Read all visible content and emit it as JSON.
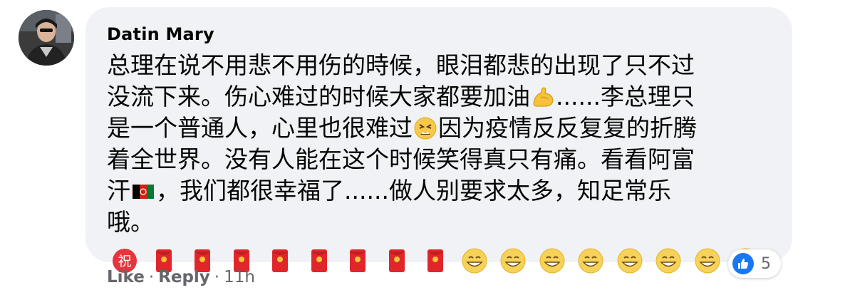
{
  "comment": {
    "author": "Datin Mary",
    "text_line1": "总理在说不用悲不用伤的時候，眼泪都悲的出现了只不过",
    "text_line2_a": "没流下来。伤心难过的时候大家都要加油",
    "text_line2_b": "......李总理只",
    "text_line3_a": "是一个普通人，心里也很难过",
    "text_line3_b": "因为疫情反反复复的折腾",
    "text_line4": "着全世界。没有人能在这个时候笑得真只有痛。看看阿富",
    "text_line5_a": "汗",
    "text_line5_b": "，我们都很幸福了......做人别要求太多，知足常乐",
    "text_line6": "哦。",
    "emojis": {
      "inline_1": "flexed-biceps-icon",
      "inline_2": "tired-face-icon",
      "inline_3": "afghanistan-flag-icon",
      "trail": [
        "congratulations-ideograph-icon",
        "red-envelope-icon",
        "red-envelope-icon",
        "red-envelope-icon",
        "red-envelope-icon",
        "red-envelope-icon",
        "red-envelope-icon",
        "red-envelope-icon",
        "red-envelope-icon",
        "grinning-face-icon",
        "grinning-face-icon",
        "grinning-face-icon",
        "grinning-face-icon",
        "grinning-face-icon",
        "grinning-face-icon",
        "grinning-face-icon",
        "grinning-face-icon"
      ]
    }
  },
  "reactions": {
    "count": "5",
    "type": "like-icon"
  },
  "actions": {
    "like": "Like",
    "reply": "Reply",
    "separator": "·",
    "time": "11h"
  },
  "colors": {
    "bubble": "#f0f2f5",
    "text": "#050505",
    "meta": "#65676b",
    "like_blue": "#1877f2"
  }
}
